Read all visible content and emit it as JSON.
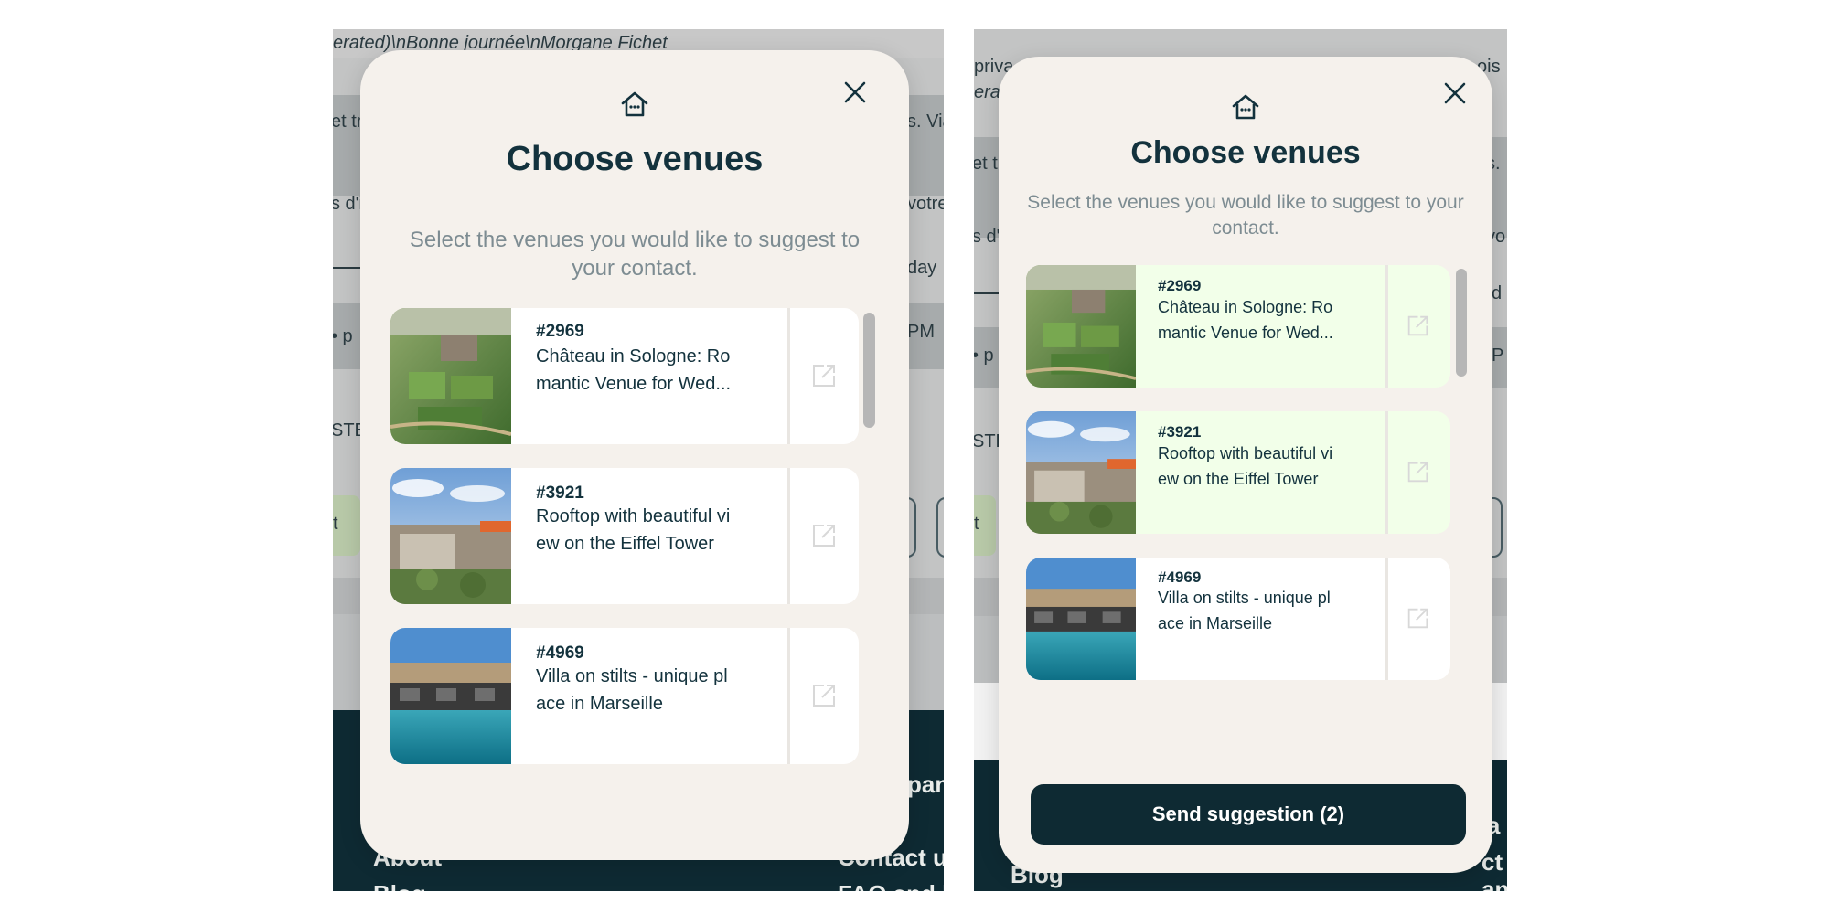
{
  "colors": {
    "primary_dark": "#0e2a33",
    "modal_bg": "#f5f1ec",
    "selected_bg": "#f2ffe9",
    "subtitle": "#7d8c92"
  },
  "left_panel": {
    "background": {
      "top_text": "erated)\\nBonne journée\\nMorgane Fichet",
      "left_snips": [
        "et tr",
        "s d'i",
        "• p",
        "STE",
        "t"
      ],
      "right_snips": [
        "s. Via",
        "votre",
        "day",
        "PM"
      ],
      "footer_left": [
        "About",
        "Blog"
      ],
      "footer_right": [
        "pany",
        "Contact u",
        "FAQ and h"
      ]
    },
    "modal": {
      "icon": "home-icon",
      "title": "Choose venues",
      "subtitle": "Select the venues you would like to suggest to your contact.",
      "venues": [
        {
          "id": "#2969",
          "name_line1": "Château in Sologne: Ro",
          "name_line2": "mantic Venue for Wed...",
          "selected": false
        },
        {
          "id": "#3921",
          "name_line1": "Rooftop with beautiful vi",
          "name_line2": "ew on the Eiffel Tower",
          "selected": false
        },
        {
          "id": "#4969",
          "name_line1": "Villa on stilts - unique pl",
          "name_line2": "ace in Marseille",
          "selected": false
        }
      ]
    }
  },
  "right_panel": {
    "background": {
      "top_text_1": "priva",
      "top_text_2": "erat",
      "top_right_1": "ois",
      "left_snips": [
        "et tr",
        "s d'i",
        "• p",
        "STE",
        "t"
      ],
      "right_snips": [
        "s.",
        "vo",
        "d",
        "P"
      ],
      "footer_left": [
        "Blog"
      ],
      "footer_right": [
        "pa",
        "ct",
        "and"
      ]
    },
    "modal": {
      "icon": "home-icon",
      "title": "Choose venues",
      "subtitle": "Select the venues you would like to suggest to your contact.",
      "venues": [
        {
          "id": "#2969",
          "name_line1": "Château in Sologne: Ro",
          "name_line2": "mantic Venue for Wed...",
          "selected": true
        },
        {
          "id": "#3921",
          "name_line1": "Rooftop with beautiful vi",
          "name_line2": "ew on the Eiffel Tower",
          "selected": true
        },
        {
          "id": "#4969",
          "name_line1": "Villa on stilts - unique pl",
          "name_line2": "ace in Marseille",
          "selected": false
        }
      ],
      "send_button_label": "Send suggestion (2)"
    }
  }
}
